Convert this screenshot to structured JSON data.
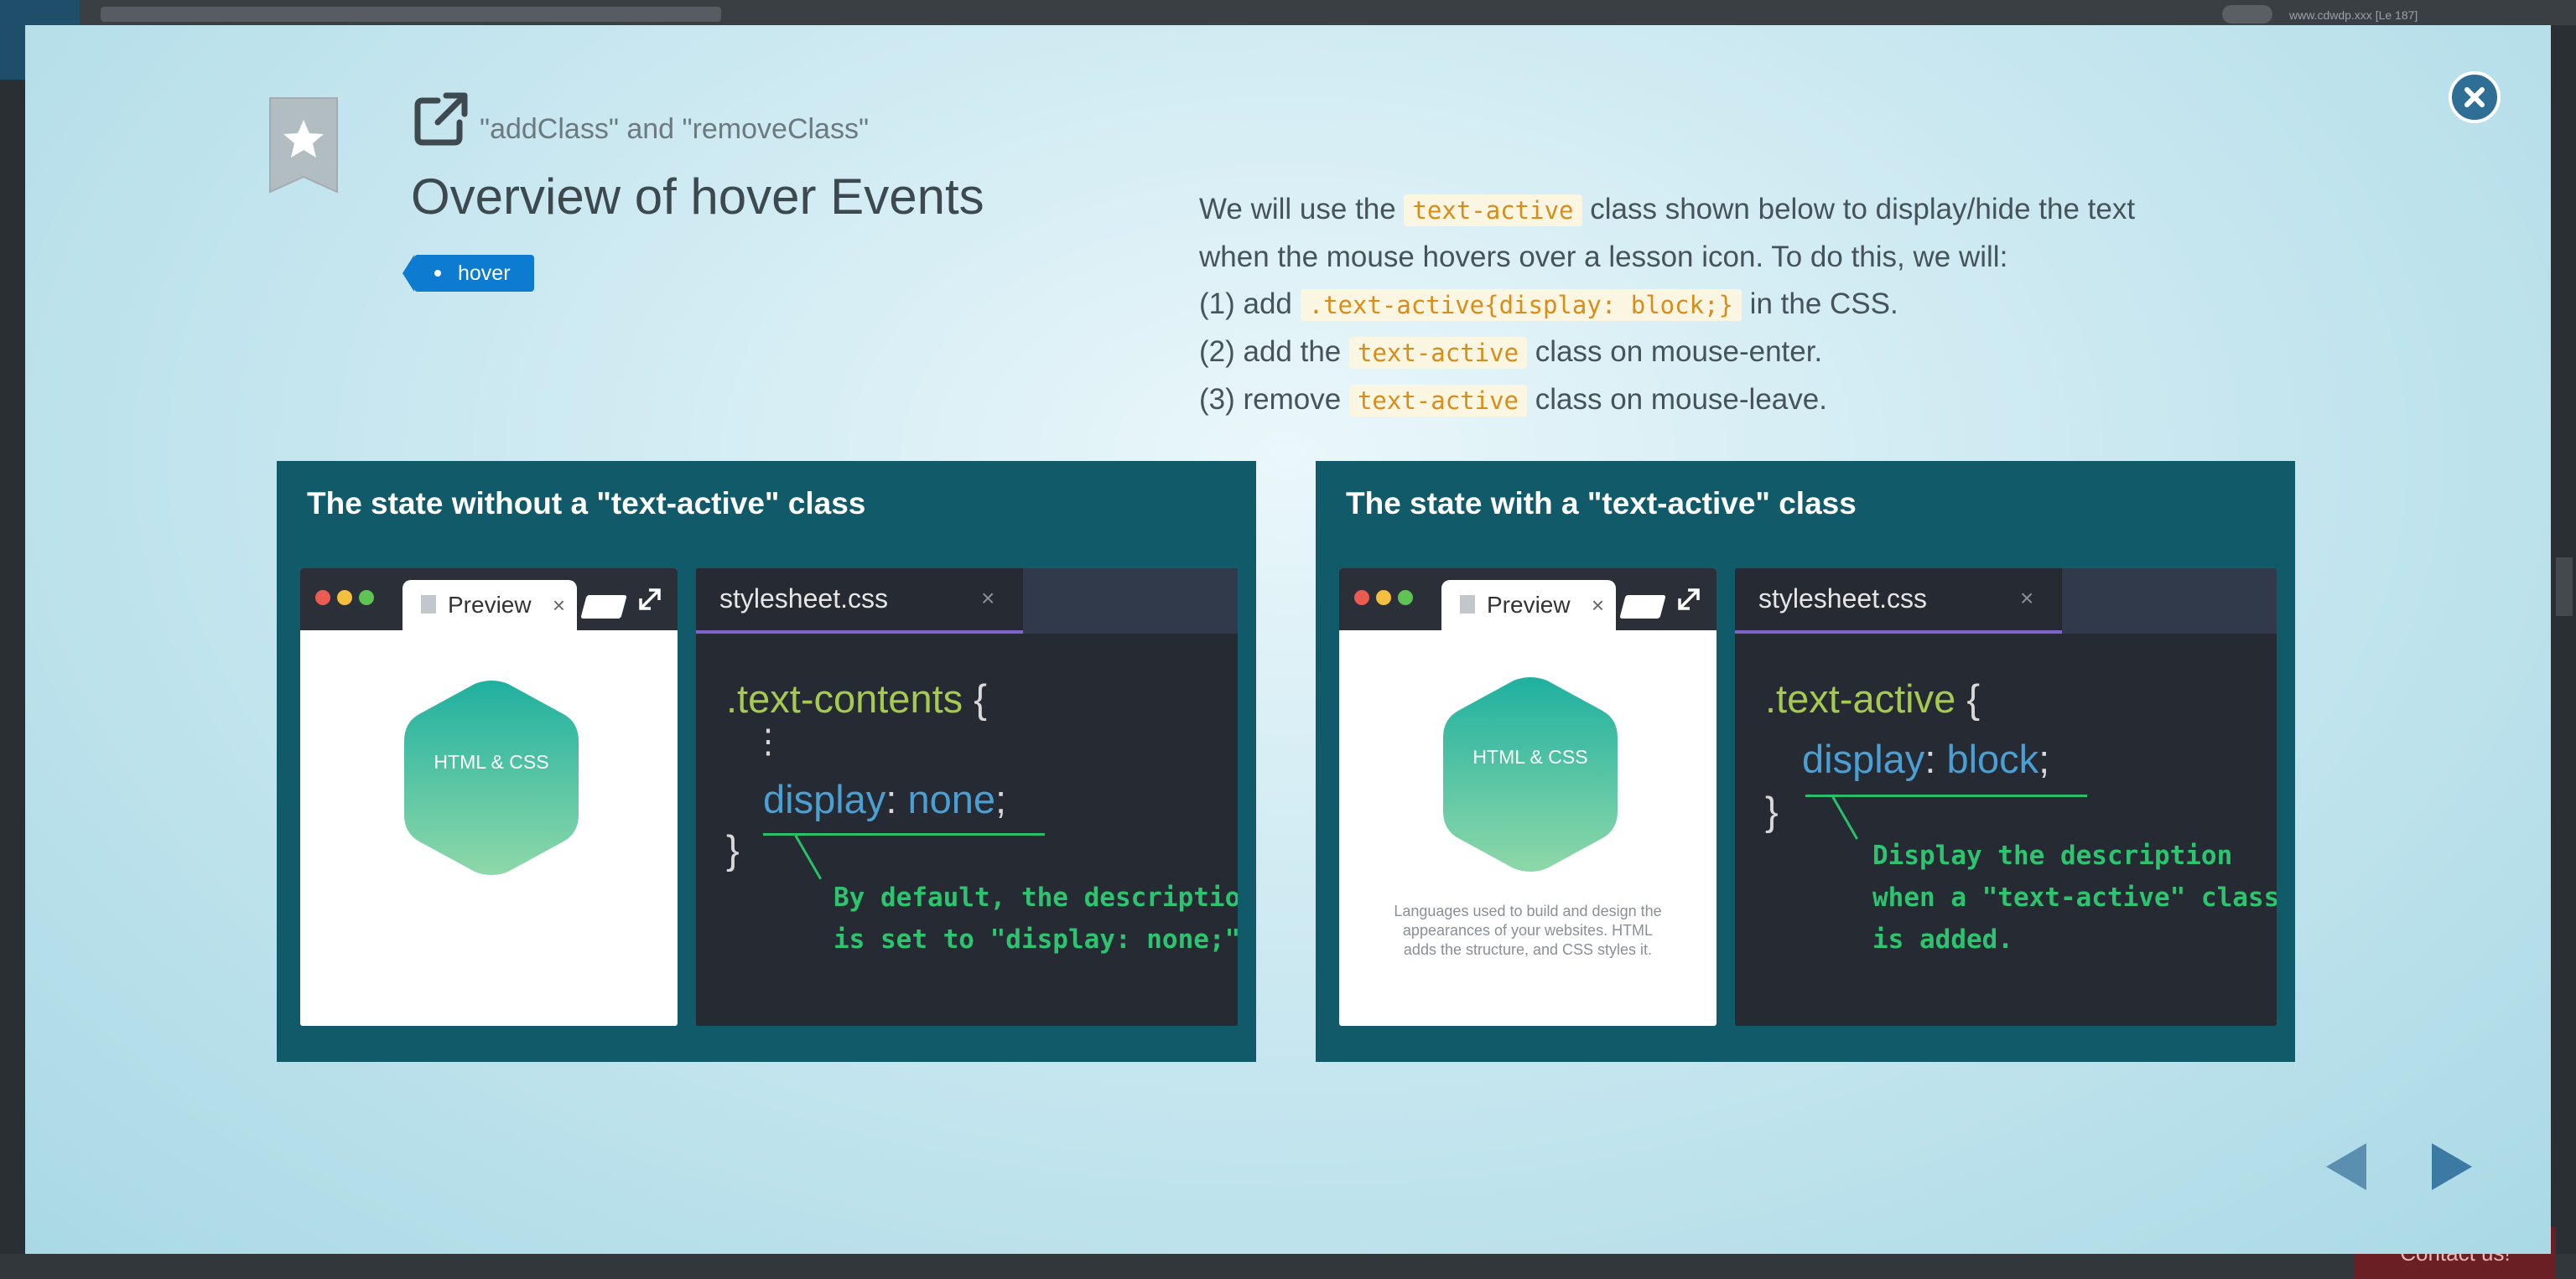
{
  "background": {
    "user_text": "www.cdwdp.xxx [Le 187]",
    "contact_label": "Contact us!"
  },
  "header": {
    "subtitle": "\"addClass\" and \"removeClass\"",
    "title": "Overview of hover Events",
    "tag": "hover"
  },
  "description": {
    "intro_a": "We will use the ",
    "intro_code": "text-active",
    "intro_b": " class shown below to display/hide the text",
    "line2": "when the mouse hovers over a lesson icon. To do this, we will:",
    "step1_prefix": "(1) add ",
    "step1_code": ".text-active{display: block;}",
    "step1_suffix": " in the CSS.",
    "step2_prefix": "(2) add the ",
    "step2_code": "text-active",
    "step2_suffix": " class on mouse-enter.",
    "step3_prefix": "(3) remove ",
    "step3_code": "text-active",
    "step3_suffix": " class on mouse-leave."
  },
  "panels": [
    {
      "title": "The state without a \"text-active\" class",
      "preview_tab": "Preview",
      "tab_close": "×",
      "hex_label": "HTML & CSS",
      "stylesheet_tab": "stylesheet.css",
      "stylesheet_close": "×",
      "code_selector": ".text-contents",
      "code_open": "{",
      "code_ellipsis": "⋮",
      "code_property": "display",
      "code_colon": ":",
      "code_value": "none",
      "code_semicolon": ";",
      "code_close": "}",
      "note_line1": "By default, the description",
      "note_line2": "is set to \"display: none;\"."
    },
    {
      "title": "The state with a \"text-active\" class",
      "preview_tab": "Preview",
      "tab_close": "×",
      "hex_label": "HTML & CSS",
      "preview_description": "Languages used to build and design the appearances of your websites. HTML adds the structure, and CSS styles it.",
      "stylesheet_tab": "stylesheet.css",
      "stylesheet_close": "×",
      "code_selector": ".text-active",
      "code_open": "{",
      "code_property": "display",
      "code_colon": ":",
      "code_value": "block",
      "code_semicolon": ";",
      "code_close": "}",
      "note_line1": "Display the description",
      "note_line2": "when a \"text-active\" class",
      "note_line3": "is added."
    }
  ],
  "colors": {
    "panel_bg": "#115a6a",
    "tag_bg": "#0c7bd0",
    "close_bg": "#2f6f95",
    "note_green": "#2ec46f",
    "code_orange": "#d88d1a"
  }
}
